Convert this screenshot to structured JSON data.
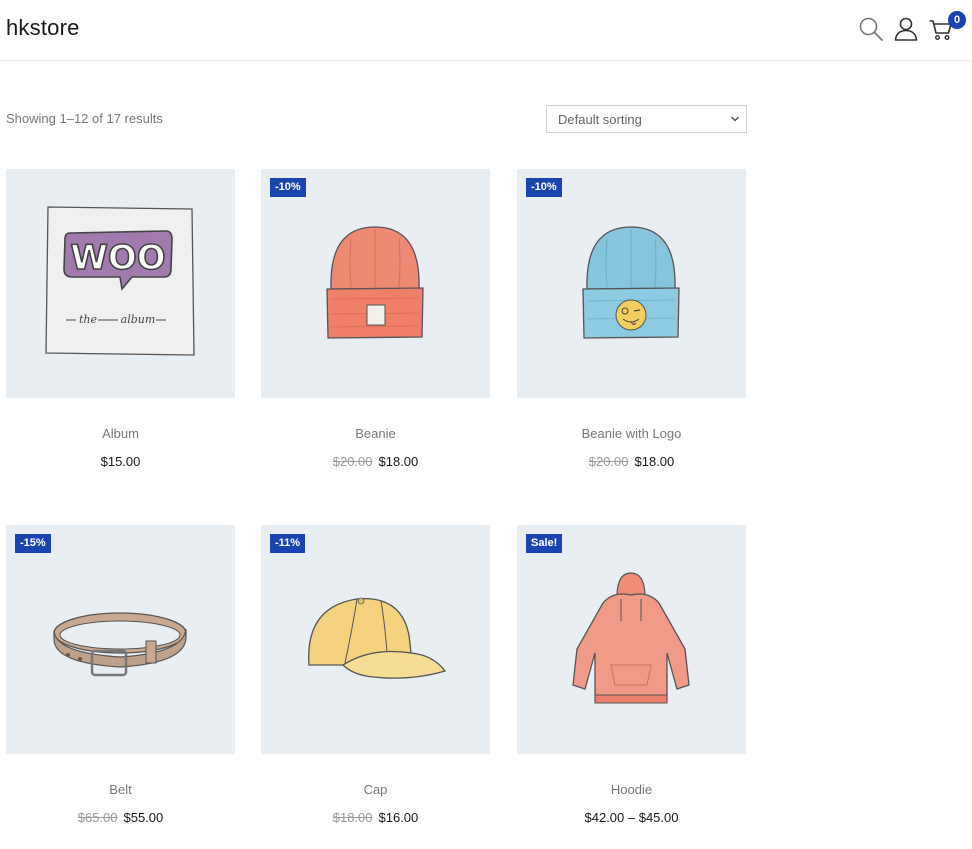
{
  "site": {
    "title": "hkstore",
    "cart_count": "0"
  },
  "header_icons": {
    "search": "search-icon",
    "account": "user-icon",
    "cart": "cart-icon"
  },
  "toolbar": {
    "result_count": "Showing 1–12 of 17 results",
    "sort_selected": "Default sorting"
  },
  "colors": {
    "accent": "#1a45b0",
    "thumb_bg": "#e9eef3"
  },
  "products": [
    {
      "name": "Album",
      "badge": "",
      "old_price": "",
      "price": "$15.00"
    },
    {
      "name": "Beanie",
      "badge": "-10%",
      "old_price": "$20.00",
      "price": "$18.00"
    },
    {
      "name": "Beanie with Logo",
      "badge": "-10%",
      "old_price": "$20.00",
      "price": "$18.00"
    },
    {
      "name": "Belt",
      "badge": "-15%",
      "old_price": "$65.00",
      "price": "$55.00"
    },
    {
      "name": "Cap",
      "badge": "-11%",
      "old_price": "$18.00",
      "price": "$16.00"
    },
    {
      "name": "Hoodie",
      "badge": "Sale!",
      "old_price": "",
      "price": "$42.00 – $45.00"
    }
  ]
}
